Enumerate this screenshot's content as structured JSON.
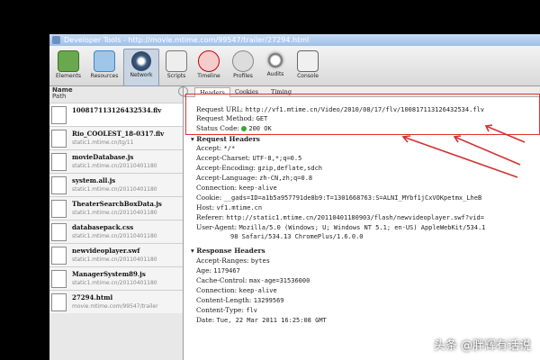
{
  "window": {
    "title": "Developer Tools - http://movie.mtime.com/99547/trailer/27294.html"
  },
  "toolbar": {
    "items": [
      {
        "label": "Elements",
        "icon": "elements-icon"
      },
      {
        "label": "Resources",
        "icon": "resources-icon"
      },
      {
        "label": "Network",
        "icon": "network-icon"
      },
      {
        "label": "Scripts",
        "icon": "scripts-icon"
      },
      {
        "label": "Timeline",
        "icon": "timeline-icon"
      },
      {
        "label": "Profiles",
        "icon": "profiles-icon"
      },
      {
        "label": "Audits",
        "icon": "audits-icon"
      },
      {
        "label": "Console",
        "icon": "console-icon"
      }
    ]
  },
  "sidebar": {
    "header_name": "Name",
    "header_path": "Path",
    "files": [
      {
        "name": "100817113126432534.flv",
        "path": ""
      },
      {
        "name": "Rio_COOLEST_18-0317.flv",
        "path": "static1.mtime.cn/tg/11"
      },
      {
        "name": "movieDatabase.js",
        "path": "static1.mtime.cn/20110401180"
      },
      {
        "name": "system.all.js",
        "path": "static1.mtime.cn/20110401180"
      },
      {
        "name": "TheaterSearchBoxData.js",
        "path": "static1.mtime.cn/20110401180"
      },
      {
        "name": "databasepack.css",
        "path": "static1.mtime.cn/20110401180"
      },
      {
        "name": "newvideoplayer.swf",
        "path": "static1.mtime.cn/20110401180"
      },
      {
        "name": "ManagerSystem89.js",
        "path": "static1.mtime.cn/20110401180"
      },
      {
        "name": "27294.html",
        "path": "movie.mtime.com/99547/trailer"
      }
    ]
  },
  "tabs": [
    "Headers",
    "Cookies",
    "Timing"
  ],
  "general": {
    "request_url_label": "Request URL:",
    "request_url": "http://vf1.mtime.cn/Video/2010/08/17/flv/100817113126432534.flv",
    "request_method_label": "Request Method:",
    "request_method": "GET",
    "status_code_label": "Status Code:",
    "status_code": "200 OK"
  },
  "request_headers": {
    "title": "Request Headers",
    "items": [
      {
        "k": "Accept:",
        "v": "*/*"
      },
      {
        "k": "Accept-Charset:",
        "v": "UTF-8,*;q=0.5"
      },
      {
        "k": "Accept-Encoding:",
        "v": "gzip,deflate,sdch"
      },
      {
        "k": "Accept-Language:",
        "v": "zh-CN,zh;q=0.8"
      },
      {
        "k": "Connection:",
        "v": "keep-alive"
      },
      {
        "k": "Cookie:",
        "v": "__gads=ID=a1b5a957791de8b9:T=1301668763:S=ALNI_MYbf1jCxVOKpetmx_LheB"
      },
      {
        "k": "Host:",
        "v": "vf1.mtime.cn"
      },
      {
        "k": "Referer:",
        "v": "http://static1.mtime.cn/20110401180903/flash/newvideoplayer.swf?vid="
      },
      {
        "k": "User-Agent:",
        "v": "Mozilla/5.0 (Windows; U; Windows NT 5.1; en-US) AppleWebKit/534.1"
      },
      {
        "k": "",
        "v": "98 Safari/534.13 ChromePlus/1.6.0.0"
      }
    ]
  },
  "response_headers": {
    "title": "Response Headers",
    "items": [
      {
        "k": "Accept-Ranges:",
        "v": "bytes"
      },
      {
        "k": "Age:",
        "v": "1179467"
      },
      {
        "k": "Cache-Control:",
        "v": "max-age=31536000"
      },
      {
        "k": "Connection:",
        "v": "keep-alive"
      },
      {
        "k": "Content-Length:",
        "v": "13299569"
      },
      {
        "k": "Content-Type:",
        "v": "flv"
      },
      {
        "k": "Date:",
        "v": "Tue, 22 Mar 2011 16:25:08 GMT"
      }
    ]
  },
  "watermark": "头条 @胖辉有话说",
  "colors": {
    "highlight": "#d33333",
    "status_ok": "#33aa33"
  }
}
